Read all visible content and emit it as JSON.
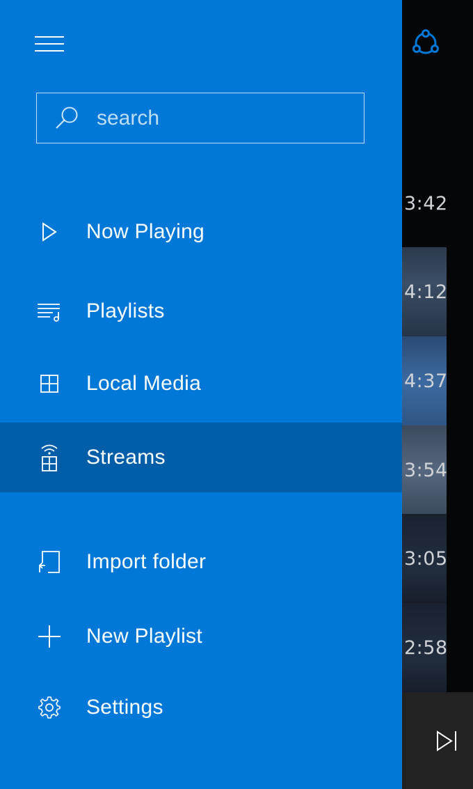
{
  "search": {
    "placeholder": "search",
    "value": ""
  },
  "nav": {
    "items": [
      {
        "label": "Now Playing",
        "icon": "play-icon"
      },
      {
        "label": "Playlists",
        "icon": "playlist-icon"
      },
      {
        "label": "Local Media",
        "icon": "grid-icon"
      },
      {
        "label": "Streams",
        "icon": "streams-icon",
        "selected": true
      }
    ],
    "actions": [
      {
        "label": "Import folder",
        "icon": "import-folder-icon"
      },
      {
        "label": "New Playlist",
        "icon": "plus-icon"
      },
      {
        "label": "Settings",
        "icon": "gear-icon"
      }
    ]
  },
  "tracks": [
    {
      "duration": "3:42"
    },
    {
      "duration": "4:12"
    },
    {
      "duration": "4:37"
    },
    {
      "duration": "3:54"
    },
    {
      "duration": "3:05"
    },
    {
      "duration": "2:58"
    }
  ],
  "colors": {
    "nav_background": "#0078d7",
    "nav_selected": "#005ea8",
    "accent": "#0078d7"
  }
}
